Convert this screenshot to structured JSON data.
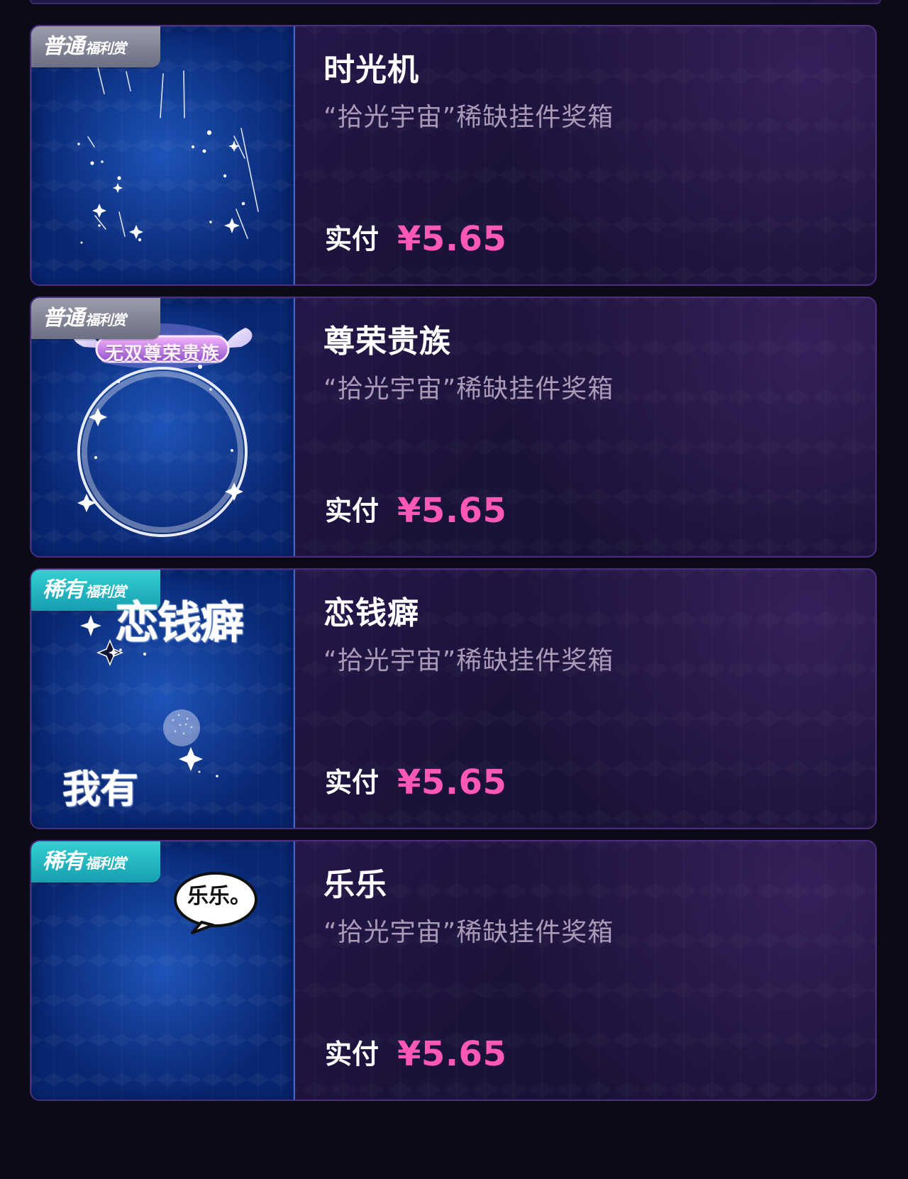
{
  "cards": [
    {
      "badge_main": "普通",
      "badge_sub": "福利赏",
      "title": "时光机",
      "subtitle": "“拾光宇宙”稀缺挂件奖箱",
      "pay_label": "实付",
      "price": "¥5.65"
    },
    {
      "badge_main": "普通",
      "badge_sub": "福利赏",
      "art_text": "无双尊荣贵族",
      "title": "尊荣贵族",
      "subtitle": "“拾光宇宙”稀缺挂件奖箱",
      "pay_label": "实付",
      "price": "¥5.65"
    },
    {
      "badge_main": "稀有",
      "badge_sub": "福利赏",
      "art_text_top": "恋钱癖",
      "art_text_bottom": "我有",
      "title": "恋钱癖",
      "subtitle": "“拾光宇宙”稀缺挂件奖箱",
      "pay_label": "实付",
      "price": "¥5.65"
    },
    {
      "badge_main": "稀有",
      "badge_sub": "福利赏",
      "art_text": "乐乐。",
      "title": "乐乐",
      "subtitle": "“拾光宇宙”稀缺挂件奖箱",
      "pay_label": "实付",
      "price": "¥5.65"
    }
  ],
  "colors": {
    "page_bg": "#0c0a17",
    "card_border": "#4a2d7e",
    "title": "#ffffff",
    "subtitle": "#aa9ab8",
    "price": "#ff58b6",
    "normal_badge": "#8b8d9f",
    "rare_badge": "#22b9c5",
    "thumb_blue": "#0d4bb1"
  },
  "icons": {
    "card_1_art": "sparkle-stars-art",
    "card_2_art": "angel-ring-frame-art",
    "card_3_art": "money-lover-sparkles-art",
    "card_4_art": "speech-bubble-art"
  }
}
